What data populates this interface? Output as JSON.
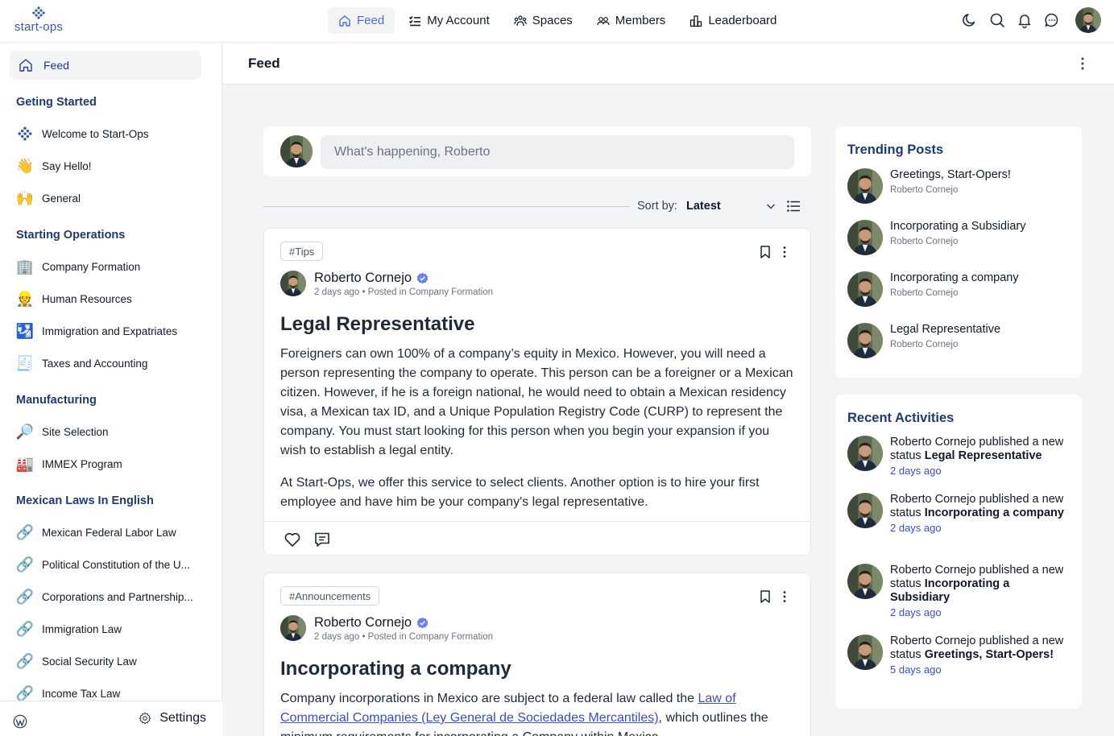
{
  "brand": {
    "name": "start-ops"
  },
  "nav": {
    "items": [
      {
        "label": "Feed",
        "icon": "home-icon"
      },
      {
        "label": "My Account",
        "icon": "list-icon"
      },
      {
        "label": "Spaces",
        "icon": "spaces-icon"
      },
      {
        "label": "Members",
        "icon": "members-icon"
      },
      {
        "label": "Leaderboard",
        "icon": "leaderboard-icon"
      }
    ],
    "right_icons": [
      "moon-icon",
      "search-icon",
      "bell-icon",
      "chat-icon",
      "avatar"
    ]
  },
  "sidebar": {
    "feed_label": "Feed",
    "sections": [
      {
        "title": "Geting Started",
        "items": [
          {
            "label": "Welcome to Start-Ops",
            "emoji": "✳"
          },
          {
            "label": "Say Hello!",
            "emoji": "👋"
          },
          {
            "label": "General",
            "emoji": "🙌"
          }
        ]
      },
      {
        "title": "Starting Operations",
        "items": [
          {
            "label": "Company Formation",
            "emoji": "🏢"
          },
          {
            "label": "Human Resources",
            "emoji": "👷"
          },
          {
            "label": "Immigration and Expatriates",
            "emoji": "🛂"
          },
          {
            "label": "Taxes and Accounting",
            "emoji": "🧾"
          }
        ]
      },
      {
        "title": "Manufacturing",
        "items": [
          {
            "label": "Site Selection",
            "emoji": "🔎"
          },
          {
            "label": "IMMEX Program",
            "emoji": "🏭"
          }
        ]
      },
      {
        "title": "Mexican Laws In English",
        "items": [
          {
            "label": "Mexican Federal Labor Law",
            "emoji": "🔗"
          },
          {
            "label": "Political Constitution of the U...",
            "emoji": "🔗"
          },
          {
            "label": "Corporations and Partnership...",
            "emoji": "🔗"
          },
          {
            "label": "Immigration Law",
            "emoji": "🔗"
          },
          {
            "label": "Social Security Law",
            "emoji": "🔗"
          },
          {
            "label": "Income Tax Law",
            "emoji": "🔗"
          }
        ]
      }
    ],
    "settings_label": "Settings"
  },
  "content": {
    "title": "Feed",
    "composer_placeholder": "What's happening, Roberto",
    "sort_label": "Sort by:",
    "sort_value": "Latest"
  },
  "posts": [
    {
      "tag": "#Tips",
      "author": "Roberto Cornejo",
      "meta": "2 days ago • Posted in Company Formation",
      "title": "Legal Representative",
      "paragraphs": [
        "Foreigners can own 100% of a company’s equity in Mexico. However, you will need a person representing the company to operate. This person can be a foreigner or a Mexican citizen. However, if he is a foreign national, he would need to obtain a Mexican residency visa, a Mexican tax ID, and a Unique Population Registry Code (CURP) to represent the company. You must start looking for this person when you begin your expansion if you wish to establish a legal entity.",
        "At Start-Ops, we offer this service to select clients. Another option is to hire your first employee and have him be your company's legal representative."
      ]
    },
    {
      "tag": "#Announcements",
      "author": "Roberto Cornejo",
      "meta": "2 days ago • Posted in Company Formation",
      "title": "Incorporating a company",
      "body_before": "Company incorporations in Mexico are subject to a federal law called the ",
      "body_link": "Law of Commercial Companies (Ley General de Sociedades Mercantiles)",
      "body_after": ", which outlines the minimum requirements for incorporating a Company within Mexico."
    }
  ],
  "trending": {
    "title": "Trending Posts",
    "items": [
      {
        "title": "Greetings, Start-Opers!",
        "author": "Roberto Cornejo"
      },
      {
        "title": "Incorporating a Subsidiary",
        "author": "Roberto Cornejo"
      },
      {
        "title": "Incorporating a company",
        "author": "Roberto Cornejo"
      },
      {
        "title": "Legal Representative",
        "author": "Roberto Cornejo"
      }
    ]
  },
  "activities": {
    "title": "Recent Activities",
    "items": [
      {
        "user": "Roberto Cornejo",
        "action": " published a new status ",
        "target": "Legal Representative",
        "time": "2 days ago"
      },
      {
        "user": "Roberto Cornejo",
        "action": " published a new status ",
        "target": "Incorporating a company",
        "time": "2 days ago"
      },
      {
        "user": "Roberto Cornejo",
        "action": " published a new status ",
        "target": "Incorporating a Subsidiary",
        "time": "2 days ago"
      },
      {
        "user": "Roberto Cornejo",
        "action": " published a new status ",
        "target": "Greetings, Start-Opers!",
        "time": "5 days ago"
      }
    ]
  },
  "colors": {
    "accent": "#4f6bd8",
    "heading": "#1e3a6e",
    "link": "#3b4dbf",
    "verified": "#6b7ff0"
  }
}
